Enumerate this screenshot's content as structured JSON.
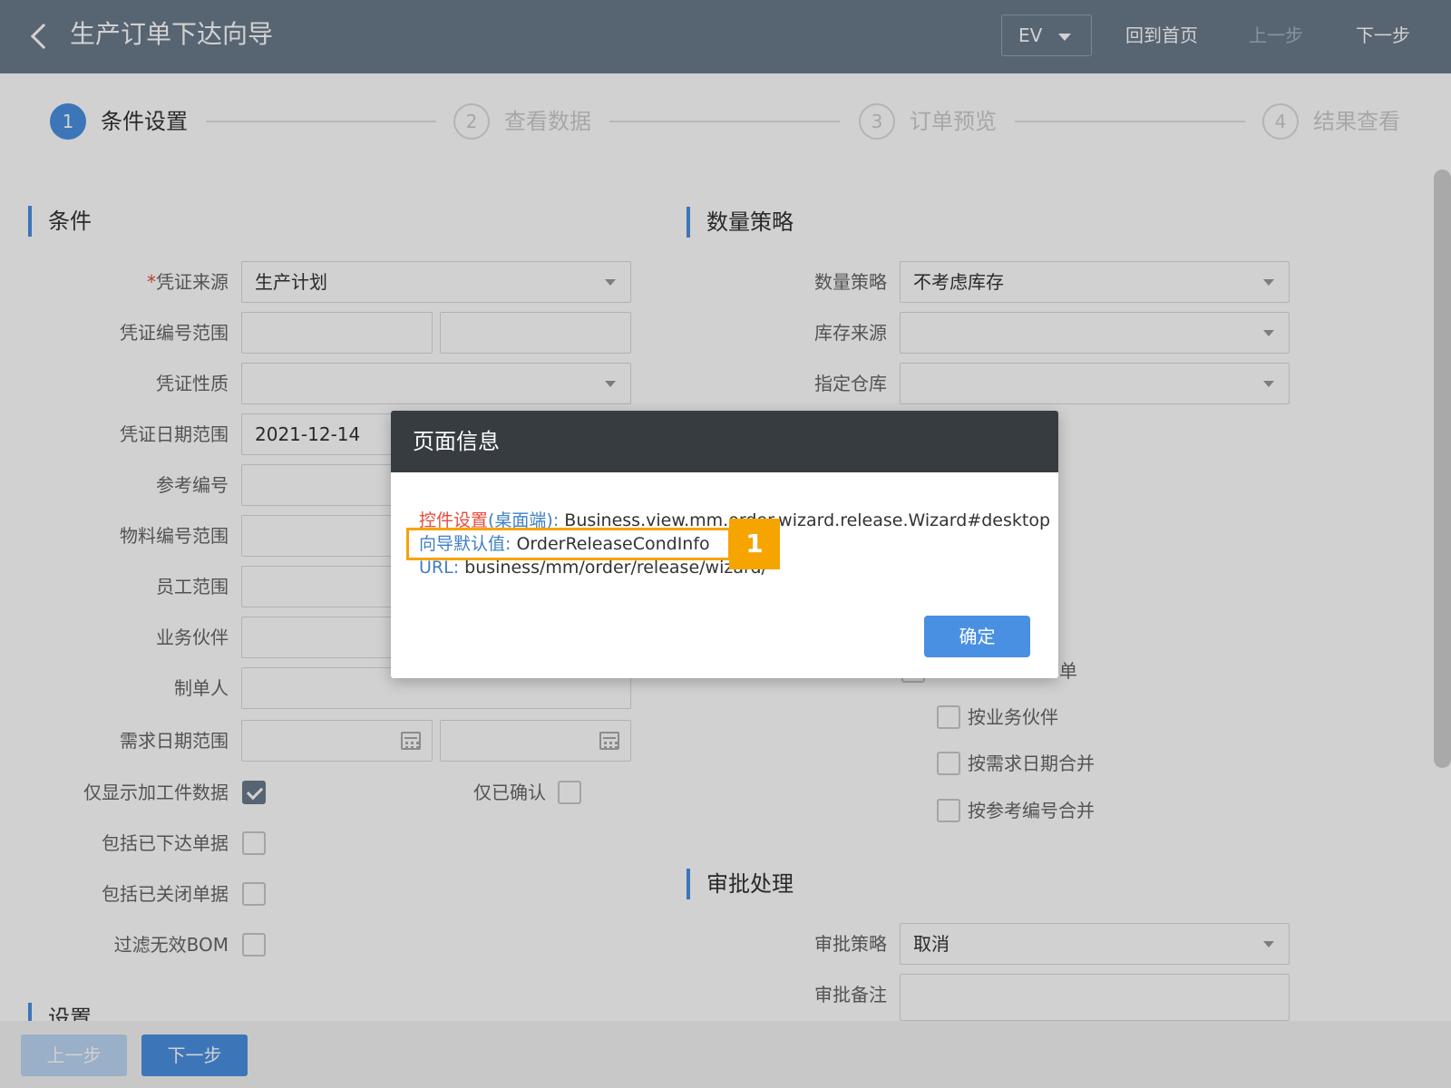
{
  "header": {
    "title": "生产订单下达向导",
    "ev_label": "EV",
    "home_label": "回到首页",
    "prev_label": "上一步",
    "next_label": "下一步"
  },
  "steps": [
    {
      "num": "1",
      "label": "条件设置",
      "active": true
    },
    {
      "num": "2",
      "label": "查看数据",
      "active": false
    },
    {
      "num": "3",
      "label": "订单预览",
      "active": false
    },
    {
      "num": "4",
      "label": "结果查看",
      "active": false
    }
  ],
  "conditions": {
    "title": "条件",
    "voucher_source_label": "凭证来源",
    "voucher_source_value": "生产计划",
    "voucher_no_range_label": "凭证编号范围",
    "voucher_nature_label": "凭证性质",
    "voucher_date_range_label": "凭证日期范围",
    "voucher_date_start": "2021-12-14",
    "ref_no_label": "参考编号",
    "material_no_range_label": "物料编号范围",
    "employee_range_label": "员工范围",
    "partner_label": "业务伙伴",
    "creator_label": "制单人",
    "demand_date_range_label": "需求日期范围",
    "only_processed_label": "仅显示加工件数据",
    "only_confirmed_label": "仅已确认",
    "include_released_label": "包括已下达单据",
    "include_closed_label": "包括已关闭单据",
    "filter_invalid_bom_label": "过滤无效BOM",
    "settings_title": "设置"
  },
  "quantity": {
    "title": "数量策略",
    "strategy_label": "数量策略",
    "strategy_value": "不考虑库存",
    "stock_source_label": "库存来源",
    "warehouse_label": "指定仓库",
    "partial_text": "单",
    "merge_partner_label": "按业务伙伴",
    "merge_demand_date_label": "按需求日期合并",
    "merge_ref_no_label": "按参考编号合并"
  },
  "approval": {
    "title": "审批处理",
    "strategy_label": "审批策略",
    "strategy_value": "取消",
    "note_label": "审批备注"
  },
  "footer": {
    "prev_label": "上一步",
    "next_label": "下一步"
  },
  "dialog": {
    "title": "页面信息",
    "control_key": "控件设置",
    "control_key_suffix": "(桌面端)",
    "control_value": "Business.view.mm.order.wizard.release.Wizard#desktop",
    "default_key": "向导默认值",
    "default_value": "OrderReleaseCondInfo",
    "url_key": "URL",
    "url_value": "business/mm/order/release/wizard/",
    "confirm_label": "确定",
    "badge": "1"
  },
  "colors": {
    "header_bg": "#6b7b8c",
    "accent": "#4a90e2",
    "highlight": "#f5a400",
    "dialog_header": "#373c41"
  }
}
